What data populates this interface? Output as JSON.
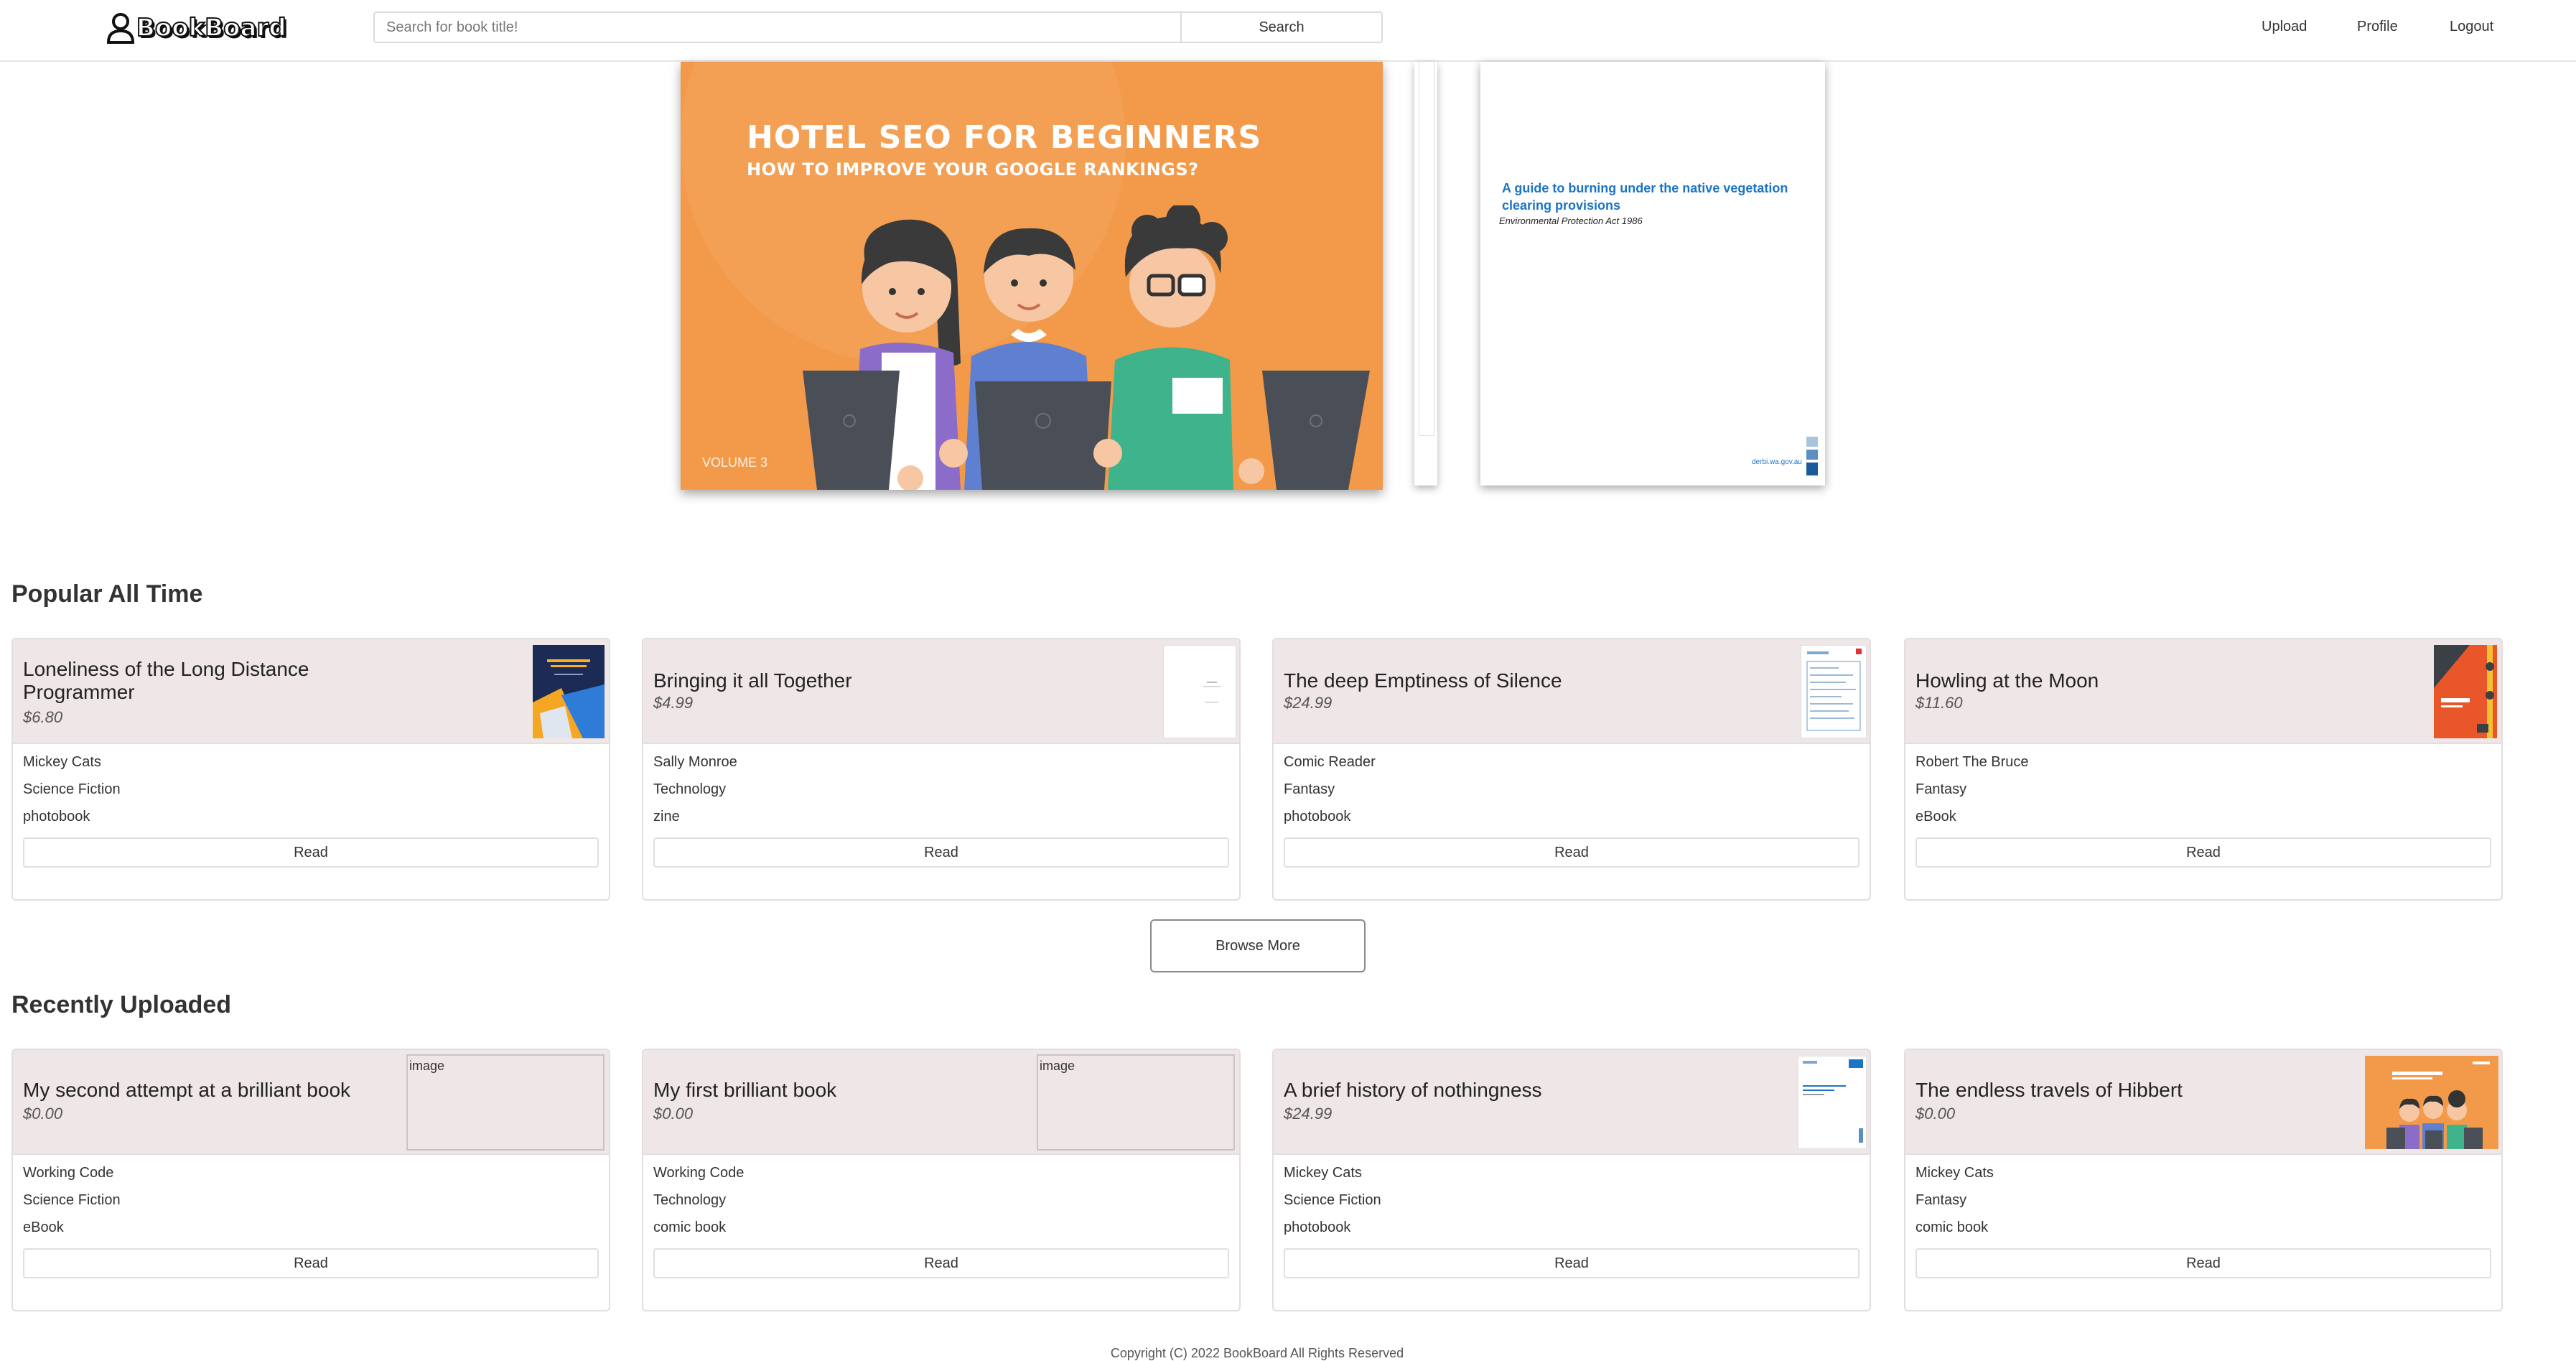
{
  "navbar": {
    "logo_text": "BookBoard",
    "search_placeholder": "Search for book title!",
    "search_button": "Search",
    "links": [
      "Upload",
      "Profile",
      "Logout"
    ]
  },
  "carousel": {
    "main": {
      "title": "HOTEL SEO FOR BEGINNERS",
      "subtitle": "HOW TO IMPROVE YOUR GOOGLE RANKINGS?",
      "volume": "VOLUME 3",
      "background_color": "#f39a4a"
    },
    "side": {
      "title": "A guide to burning under the native vegetation clearing provisions",
      "subtitle": "Environmental Protection Act 1986",
      "footer": "derbi.wa.gov.au"
    }
  },
  "popular": {
    "heading": "Popular All Time",
    "cards": [
      {
        "title": "Loneliness of the Long Distance Programmer",
        "price": "$6.80",
        "author": "Mickey Cats",
        "genre": "Science Fiction",
        "format": "photobook",
        "read_label": "Read",
        "thumb": "blue-report-cover"
      },
      {
        "title": "Bringing it all Together",
        "price": "$4.99",
        "author": "Sally Monroe",
        "genre": "Technology",
        "format": "zine",
        "read_label": "Read",
        "thumb": "white-page"
      },
      {
        "title": "The deep Emptiness of Silence",
        "price": "$24.99",
        "author": "Comic Reader",
        "genre": "Fantasy",
        "format": "photobook",
        "read_label": "Read",
        "thumb": "form-page"
      },
      {
        "title": "Howling at the Moon",
        "price": "$11.60",
        "author": "Robert The Bruce",
        "genre": "Fantasy",
        "format": "eBook",
        "read_label": "Read",
        "thumb": "orange-cover"
      }
    ]
  },
  "browse_more": "Browse More",
  "recent": {
    "heading": "Recently Uploaded",
    "cards": [
      {
        "title": "My second attempt at a brilliant book",
        "price": "$0.00",
        "author": "Working Code",
        "genre": "Science Fiction",
        "format": "eBook",
        "read_label": "Read",
        "thumb": "broken",
        "alt": "image"
      },
      {
        "title": "My first brilliant book",
        "price": "$0.00",
        "author": "Working Code",
        "genre": "Technology",
        "format": "comic book",
        "read_label": "Read",
        "thumb": "broken",
        "alt": "image"
      },
      {
        "title": "A brief history of nothingness",
        "price": "$24.99",
        "author": "Mickey Cats",
        "genre": "Science Fiction",
        "format": "photobook",
        "read_label": "Read",
        "thumb": "guide-page"
      },
      {
        "title": "The endless travels of Hibbert",
        "price": "$0.00",
        "author": "Mickey Cats",
        "genre": "Fantasy",
        "format": "comic book",
        "read_label": "Read",
        "thumb": "hotel-seo-mini"
      }
    ]
  },
  "footer": "Copyright (C) 2022 BookBoard All Rights Reserved"
}
